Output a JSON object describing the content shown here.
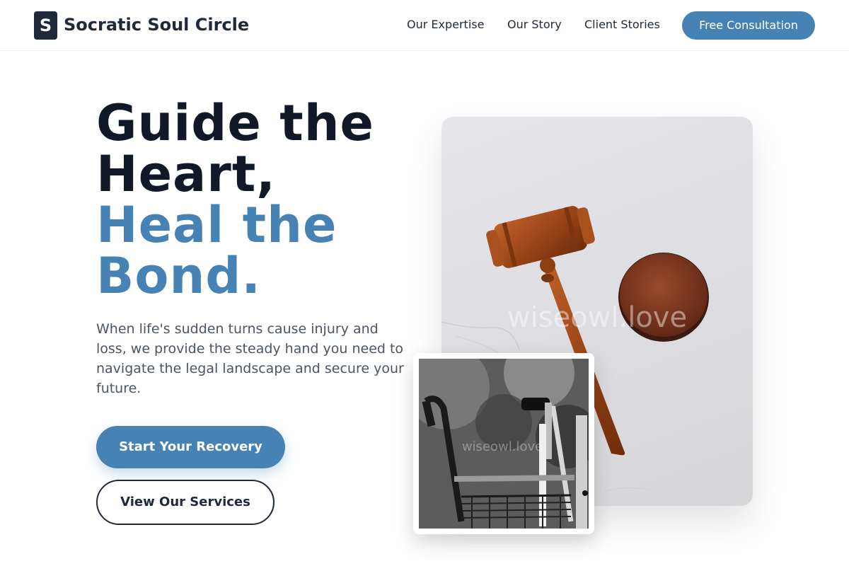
{
  "nav": {
    "logo_letter": "S",
    "brand": "Socratic Soul Circle",
    "links": [
      "Our Expertise",
      "Our Story",
      "Client Stories"
    ],
    "cta": "Free Consultation"
  },
  "hero": {
    "headline_dark": [
      "Guide the",
      "Heart,"
    ],
    "headline_blue": [
      "Heal the",
      "Bond."
    ],
    "lead": "When life's sudden turns cause injury and loss, we provide the steady hand you need to navigate the legal landscape and secure your future.",
    "primary_cta": "Start Your Recovery",
    "secondary_cta": "View Our Services"
  },
  "images": {
    "main_watermark": "wiseowl.love",
    "inset_watermark": "wiseowl.love"
  },
  "colors": {
    "accent": "#4682b4",
    "dark": "#1e2a3b",
    "text": "#111827",
    "muted": "#4b5563"
  }
}
